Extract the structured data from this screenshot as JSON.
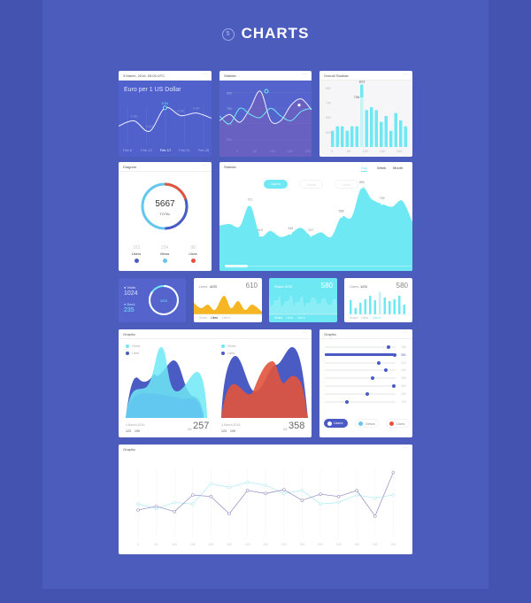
{
  "header": {
    "section_number": "5",
    "title": "CHARTS"
  },
  "cards": {
    "euro": {
      "header": "3 March, 2016, 00:00 UTC",
      "title": "Euro per 1 US Dollar",
      "highlight": "0.91"
    },
    "stat1": {
      "header": "Statistic"
    },
    "overall": {
      "header": "Overall Statistic",
      "labels": [
        "823",
        "736"
      ]
    },
    "diagram": {
      "header": "Diagram",
      "total": "5667",
      "total_label": "TOTAL",
      "legend": [
        {
          "value": "162",
          "label": "Users",
          "color": "#4a5bc4"
        },
        {
          "value": "234",
          "label": "Views",
          "color": "#62c6ee"
        },
        {
          "value": "98",
          "label": "Likes",
          "color": "#e2533c"
        }
      ]
    },
    "stat2": {
      "header": "Statistic",
      "tabs": [
        "Day",
        "Week",
        "Month"
      ],
      "active_tab": "Day",
      "toggles": [
        "Users",
        "Views",
        "Likes"
      ],
      "active_toggle": "Users"
    },
    "visits": {
      "visits_label": "Visits",
      "visits": "1024",
      "back_label": "Back",
      "back": "235",
      "ring_label": "2/03",
      "progress": 0.85
    },
    "likes": {
      "label": "Likes",
      "sub": "4/03",
      "value": "610",
      "tabs": [
        "Share",
        "Likes",
        "Users"
      ],
      "active": "Likes"
    },
    "share": {
      "label": "Share",
      "sub": "3/03",
      "value": "580",
      "tabs": [
        "Share",
        "Likes",
        "Users"
      ],
      "active": "Share"
    },
    "users": {
      "label": "Users",
      "sub": "1/03",
      "value": "580",
      "tabs": [
        "Share",
        "Likes",
        "Users"
      ],
      "active": "Users"
    },
    "graphic1": {
      "header": "Graphic",
      "left": {
        "legend": [
          "Views",
          "Likes"
        ],
        "date": "4 March,2016",
        "stats": [
          "123",
          "109"
        ],
        "total_label": "All",
        "total": "257"
      },
      "right": {
        "legend": [
          "Views",
          "Likes"
        ],
        "date": "4 March,2016",
        "stats": [
          "123",
          "109"
        ],
        "total_label": "All",
        "total": "358"
      }
    },
    "graphic2": {
      "header": "Graphic",
      "buttons": [
        "Users",
        "Views",
        "Likes"
      ]
    },
    "graphic3": {
      "header": "Graphic"
    }
  },
  "colors": {
    "bg": "#4553b0",
    "panel": "#4b5cbd",
    "blue": "#4a5bc4",
    "cyan": "#6ee9f4",
    "light_blue": "#62c6ee",
    "red": "#e2533c",
    "yellow": "#f6b623"
  },
  "chart_data": [
    {
      "id": "euro",
      "type": "line",
      "categories": [
        "Feb 8",
        "Feb 12",
        "Feb 17",
        "Feb 21",
        "Feb 28"
      ],
      "values": [
        0.84,
        0.86,
        0.82,
        0.91,
        0.88,
        0.89,
        0.87
      ],
      "point_labels": [
        "0.86",
        "0.82",
        "0.91",
        "0.88",
        "0.89"
      ]
    },
    {
      "id": "stat1",
      "type": "line",
      "x_ticks": [
        "0",
        "50",
        "100",
        "150",
        "200"
      ],
      "y_ticks": [
        "800",
        "700",
        "600",
        "500"
      ],
      "ylim": [
        450,
        850
      ],
      "series": [
        {
          "values": [
            620,
            660,
            610,
            700,
            810,
            620,
            620,
            720,
            760,
            690
          ]
        },
        {
          "values": [
            650,
            600,
            700,
            660,
            640,
            700,
            650,
            620,
            680,
            700
          ]
        }
      ]
    },
    {
      "id": "overall",
      "type": "bar",
      "x_ticks": [
        "0",
        "50",
        "100",
        "150",
        "200"
      ],
      "y_ticks": [
        "800",
        "700",
        "600",
        "500"
      ],
      "ylim": [
        400,
        850
      ],
      "values": [
        510,
        540,
        540,
        510,
        540,
        540,
        823,
        650,
        670,
        650,
        570,
        610,
        510,
        630,
        580,
        540
      ]
    },
    {
      "id": "stat2",
      "type": "area",
      "values": [
        450,
        470,
        440,
        721,
        319,
        380,
        300,
        343,
        420,
        317,
        360,
        300,
        568,
        560,
        955,
        800,
        739,
        700,
        780,
        500
      ],
      "point_labels": [
        "721",
        "319",
        "343",
        "317",
        "568",
        "955",
        "739"
      ]
    },
    {
      "id": "bars_list",
      "type": "bar",
      "orientation": "horizontal",
      "values": [
        356,
        391,
        304,
        340,
        268,
        389,
        235,
        123
      ],
      "max": 400
    },
    {
      "id": "graphic3",
      "type": "line",
      "x_ticks": [
        "0",
        "50",
        "100",
        "150",
        "200",
        "100",
        "150",
        "200",
        "100",
        "150",
        "200",
        "100",
        "150",
        "200",
        "100"
      ],
      "series": [
        {
          "values": [
            40,
            45,
            38,
            60,
            58,
            35,
            66,
            62,
            67,
            53,
            61,
            58,
            66,
            32,
            90
          ]
        },
        {
          "values": [
            48,
            42,
            50,
            48,
            75,
            70,
            77,
            73,
            62,
            66,
            48,
            50,
            60,
            56,
            60
          ]
        }
      ]
    }
  ]
}
